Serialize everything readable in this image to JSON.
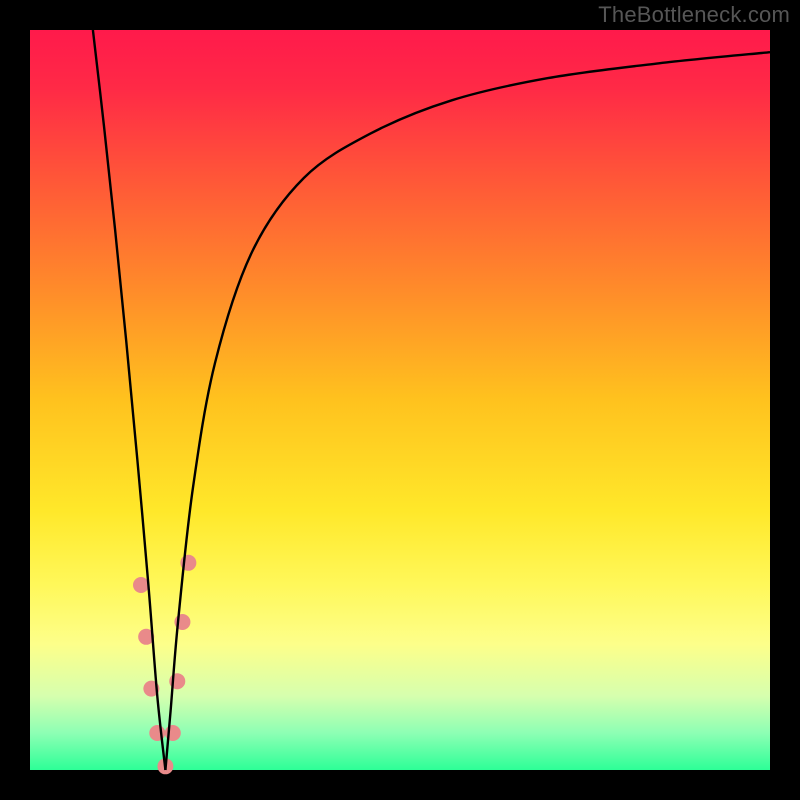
{
  "watermark": "TheBottleneck.com",
  "chart_data": {
    "type": "line",
    "title": "",
    "xlabel": "",
    "ylabel": "",
    "xlim": [
      0,
      100
    ],
    "ylim": [
      0,
      100
    ],
    "background_gradient": {
      "stops": [
        {
          "offset": 0.0,
          "color": "#ff1a4b"
        },
        {
          "offset": 0.08,
          "color": "#ff2a46"
        },
        {
          "offset": 0.2,
          "color": "#ff5638"
        },
        {
          "offset": 0.35,
          "color": "#ff8b2a"
        },
        {
          "offset": 0.5,
          "color": "#ffc21e"
        },
        {
          "offset": 0.65,
          "color": "#ffe82a"
        },
        {
          "offset": 0.75,
          "color": "#fff85a"
        },
        {
          "offset": 0.83,
          "color": "#fdff8a"
        },
        {
          "offset": 0.9,
          "color": "#d6ffae"
        },
        {
          "offset": 0.95,
          "color": "#8dffb4"
        },
        {
          "offset": 1.0,
          "color": "#2dff97"
        }
      ]
    },
    "series": [
      {
        "name": "left-branch",
        "x": [
          8.5,
          10.0,
          11.5,
          13.0,
          14.5,
          16.0,
          17.2,
          18.3
        ],
        "y": [
          100,
          87,
          73,
          58,
          42,
          25,
          10,
          0
        ]
      },
      {
        "name": "right-branch",
        "x": [
          18.3,
          19.0,
          20.0,
          22.0,
          25.0,
          30.0,
          37.0,
          46.0,
          57.0,
          70.0,
          85.0,
          100.0
        ],
        "y": [
          0,
          8,
          20,
          38,
          55,
          70,
          80,
          86,
          90.5,
          93.5,
          95.5,
          97.0
        ]
      }
    ],
    "markers": {
      "name": "highlight-dots",
      "color": "#e98a8a",
      "radius": 8,
      "points": [
        {
          "x": 15.0,
          "y": 25
        },
        {
          "x": 15.7,
          "y": 18
        },
        {
          "x": 16.4,
          "y": 11
        },
        {
          "x": 17.2,
          "y": 5
        },
        {
          "x": 18.3,
          "y": 0.5
        },
        {
          "x": 19.3,
          "y": 5
        },
        {
          "x": 19.9,
          "y": 12
        },
        {
          "x": 20.6,
          "y": 20
        },
        {
          "x": 21.4,
          "y": 28
        }
      ]
    },
    "frame": {
      "inner_x": 30,
      "inner_y": 30,
      "inner_w": 740,
      "inner_h": 740
    }
  }
}
